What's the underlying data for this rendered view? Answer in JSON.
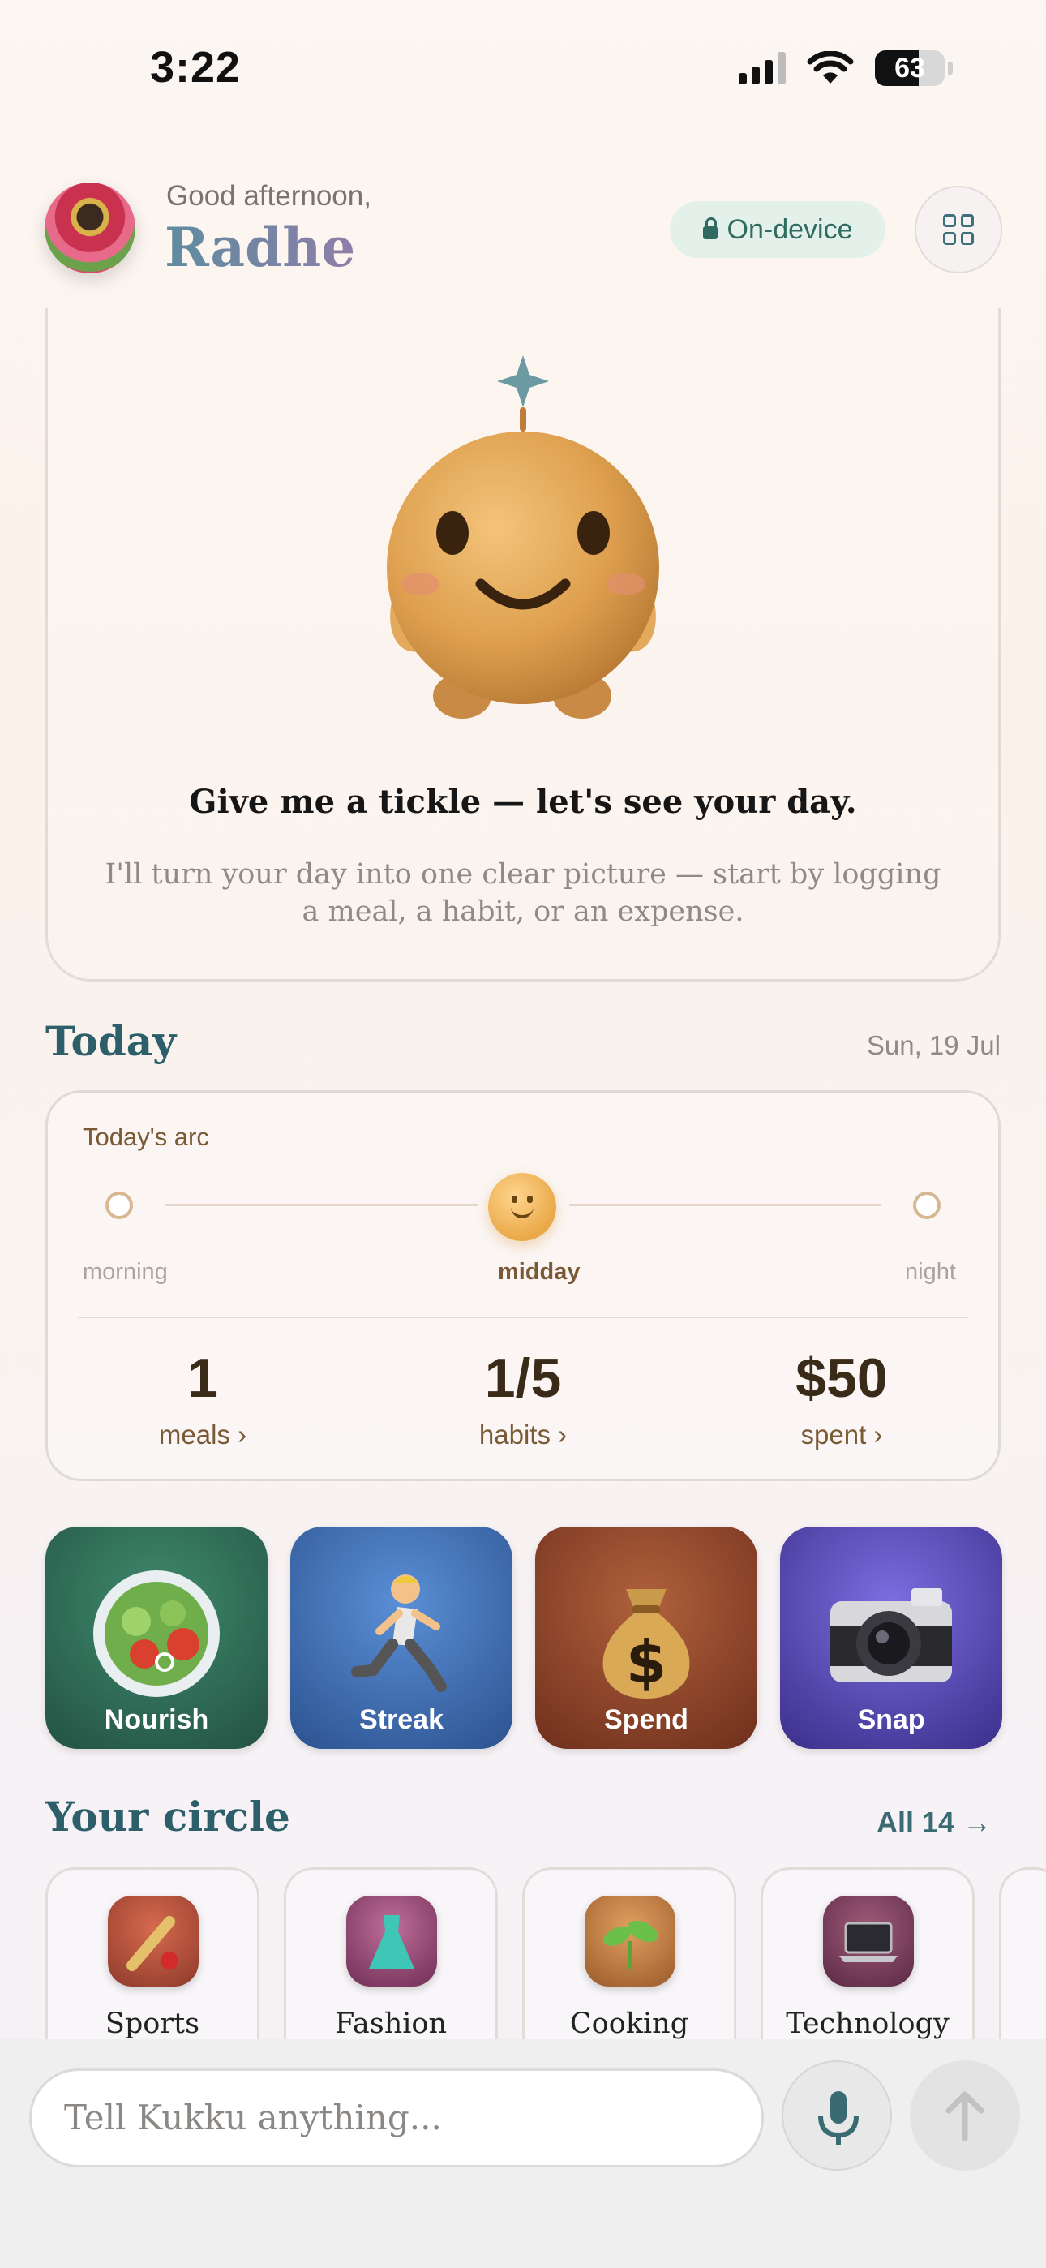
{
  "status_bar": {
    "time": "3:22",
    "battery": "63",
    "battery_level": 0.63
  },
  "header": {
    "greeting": "Good afternoon,",
    "name": "Radhe",
    "privacy_chip": "On-device",
    "menu_icon": "grid-icon"
  },
  "hero": {
    "title": "Give me a tickle — let's see your day.",
    "subtitle": "I'll turn your day into one clear picture — start by logging a meal, a habit, or an expense."
  },
  "today": {
    "title": "Today",
    "date": "Sun, 19 Jul",
    "arc_label": "Today's arc",
    "times": [
      "morning",
      "midday",
      "night"
    ],
    "active_time": "midday",
    "stats": [
      {
        "value": "1",
        "label": "meals ›"
      },
      {
        "value": "1/5",
        "label": "habits ›"
      },
      {
        "value": "$50",
        "label": "spent ›"
      }
    ]
  },
  "tiles": [
    {
      "label": "Nourish",
      "icon": "salad-icon",
      "color": "#2f6b55"
    },
    {
      "label": "Streak",
      "icon": "runner-icon",
      "color": "#3a67a8"
    },
    {
      "label": "Spend",
      "icon": "money-bag-icon",
      "color": "#8a3f25"
    },
    {
      "label": "Snap",
      "icon": "camera-icon",
      "color": "#4b3a9a"
    }
  ],
  "circle": {
    "title": "Your circle",
    "all_link": "All 14 →",
    "items": [
      {
        "label": "Sports",
        "icon": "cricket-icon"
      },
      {
        "label": "Fashion",
        "icon": "dress-icon"
      },
      {
        "label": "Cooking",
        "icon": "seedling-icon"
      },
      {
        "label": "Technology",
        "icon": "laptop-icon"
      }
    ]
  },
  "composer": {
    "placeholder": "Tell Kukku anything..."
  }
}
